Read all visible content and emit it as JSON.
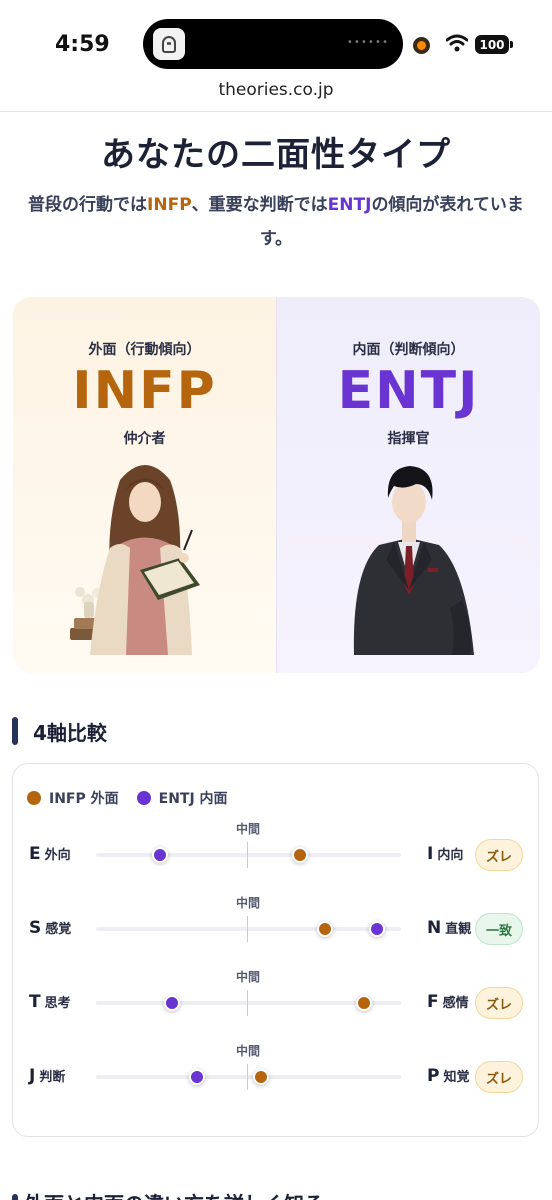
{
  "status_bar": {
    "time": "4:59",
    "battery": "100",
    "island_dots": "••••••",
    "icons": [
      "app-icon",
      "record-icon",
      "wifi-icon",
      "battery-icon"
    ]
  },
  "browser": {
    "url": "theories.co.jp"
  },
  "header": {
    "title": "あなたの二面性タイプ",
    "lead_1": "普段の行動では",
    "lead_outer_type": "INFP",
    "lead_2": "、重要な判断では",
    "lead_inner_type": "ENTJ",
    "lead_3": "の傾向が表れています。"
  },
  "cards": {
    "outer": {
      "label": "外面（行動傾向）",
      "code": "INFP",
      "name": "仲介者",
      "portrait": "reading-woman-illustration"
    },
    "inner": {
      "label": "内面（判断傾向）",
      "code": "ENTJ",
      "name": "指揮官",
      "portrait": "suited-man-illustration"
    }
  },
  "axes_section": {
    "title": "4軸比較",
    "legend": [
      {
        "label": "INFP 外面",
        "color": "#b5650d"
      },
      {
        "label": "ENTJ 内面",
        "color": "#6a34d2"
      }
    ],
    "mid_label": "中間",
    "rows": [
      {
        "left_letter": "E",
        "left_word": "外向",
        "right_letter": "I",
        "right_word": "内向",
        "outer": 0.67,
        "inner": 0.21,
        "status": "ズレ",
        "match": false
      },
      {
        "left_letter": "S",
        "left_word": "感覚",
        "right_letter": "N",
        "right_word": "直観",
        "outer": 0.75,
        "inner": 0.92,
        "status": "一致",
        "match": true
      },
      {
        "left_letter": "T",
        "left_word": "思考",
        "right_letter": "F",
        "right_word": "感情",
        "outer": 0.88,
        "inner": 0.25,
        "status": "ズレ",
        "match": false
      },
      {
        "left_letter": "J",
        "left_word": "判断",
        "right_letter": "P",
        "right_word": "知覚",
        "outer": 0.54,
        "inner": 0.33,
        "status": "ズレ",
        "match": false
      }
    ]
  },
  "next_section": {
    "title": "外面と内面の違い方を詳しく知る"
  },
  "colors": {
    "outer_accent": "#b5650d",
    "inner_accent": "#6a34d2",
    "match": "#2f7a44",
    "mismatch": "#8a5a10"
  }
}
